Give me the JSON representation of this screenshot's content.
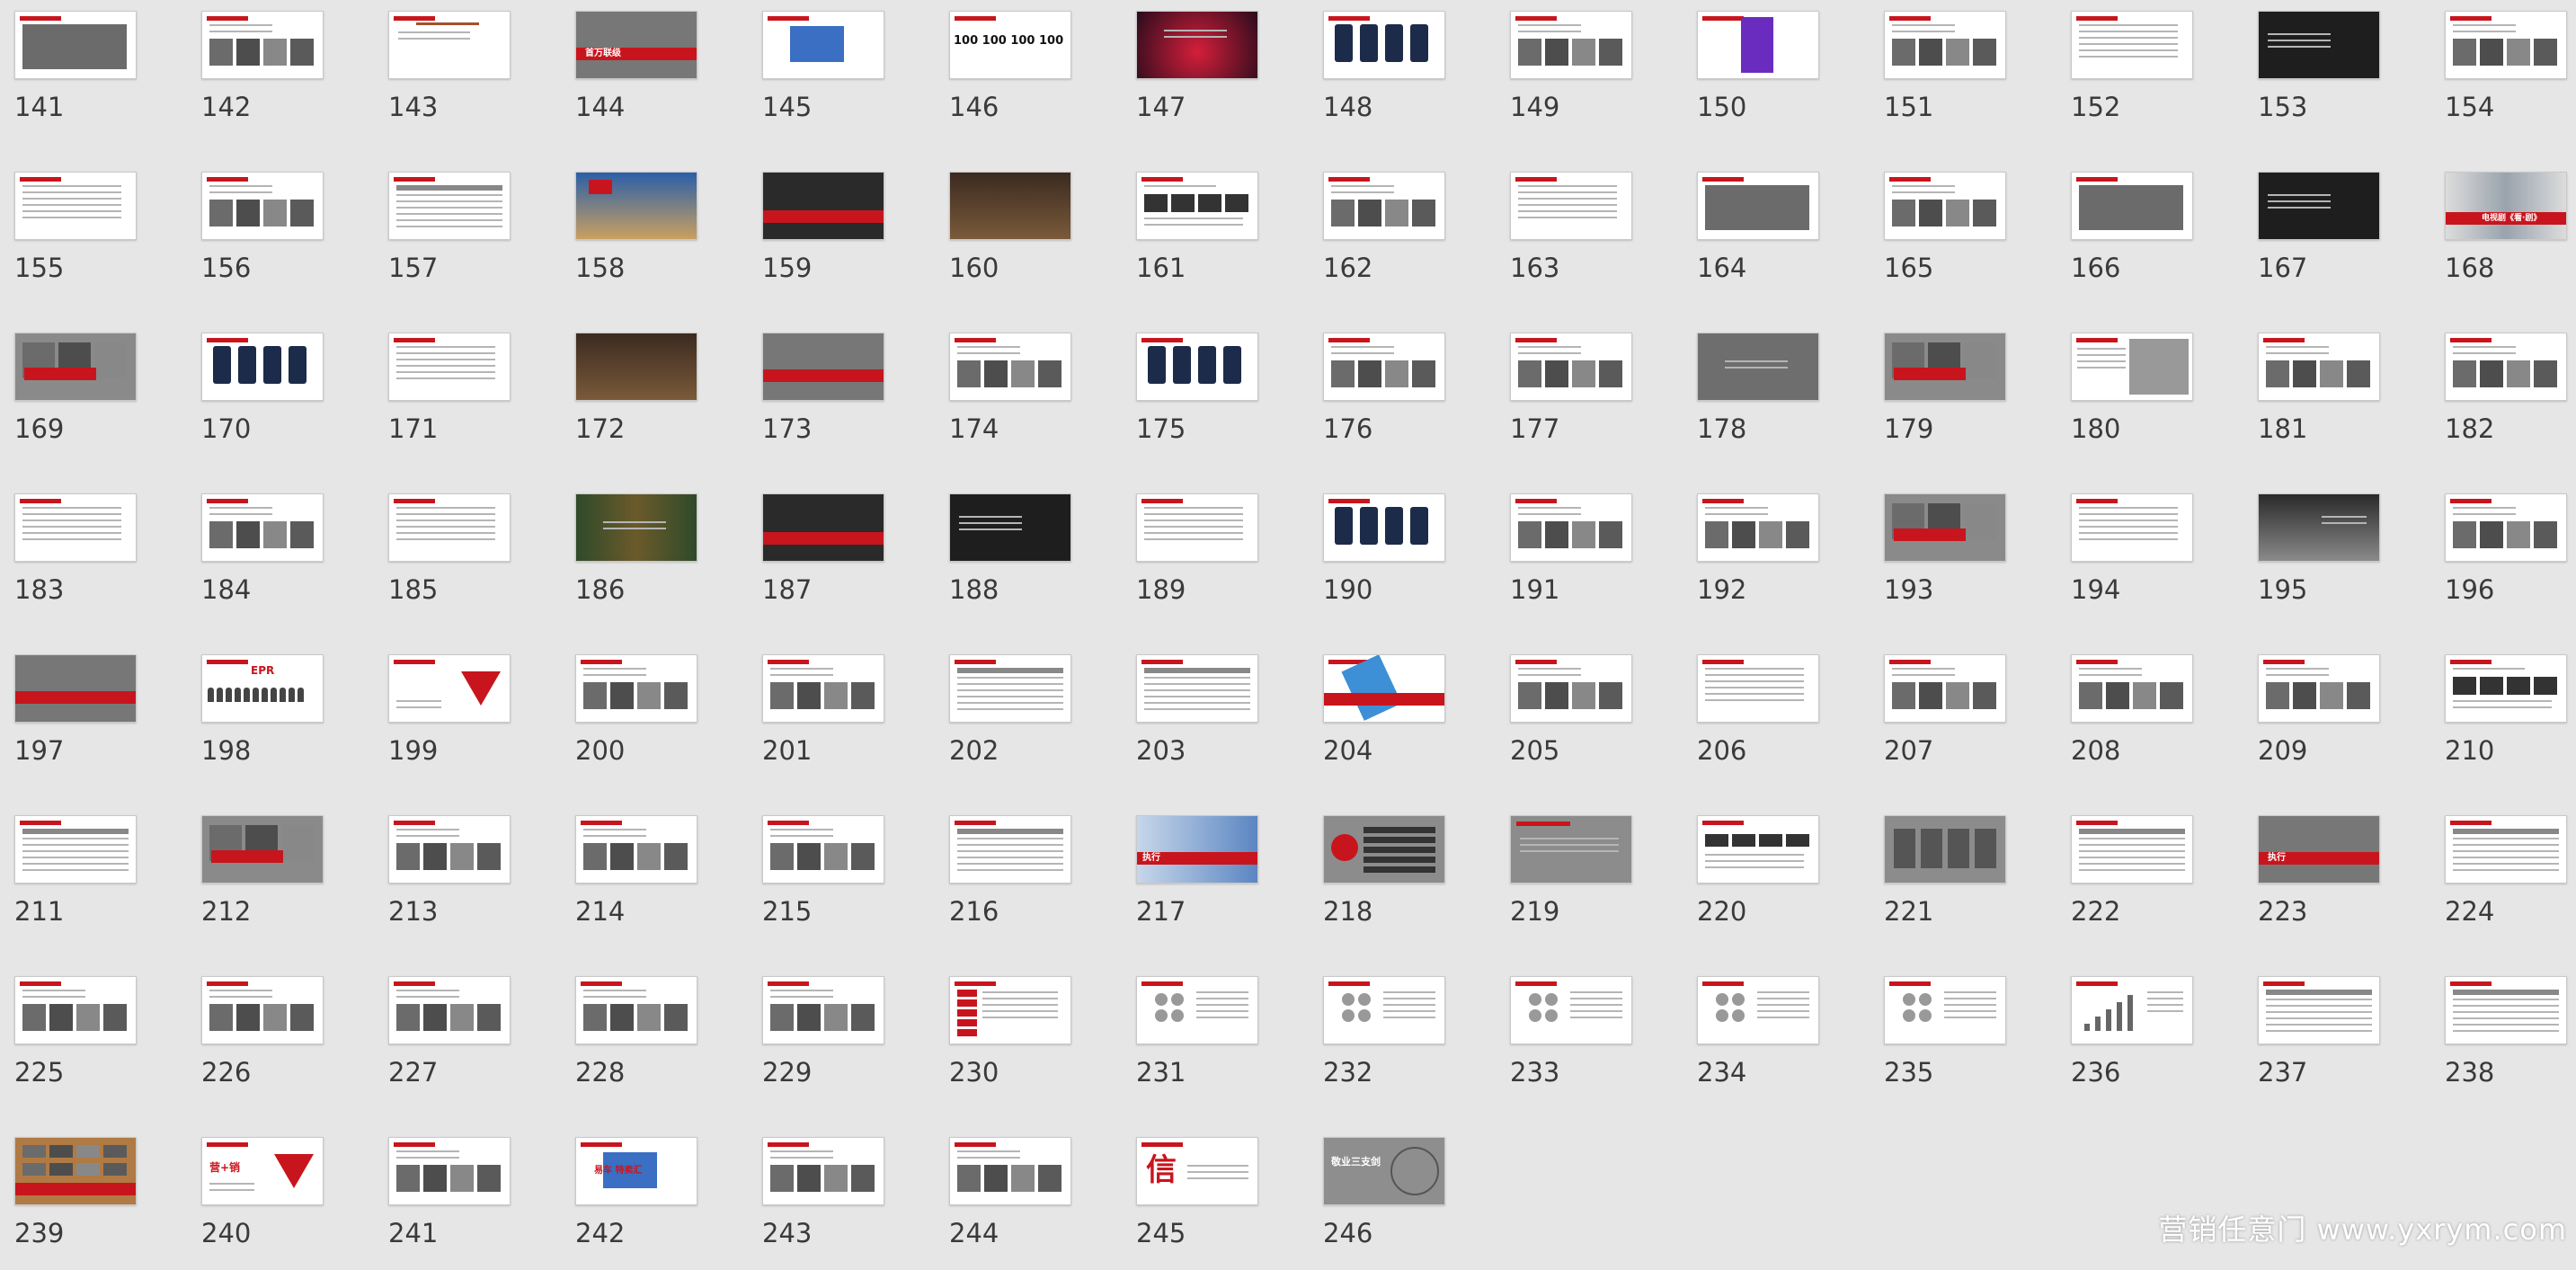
{
  "slides": [
    {
      "number": "141",
      "style": "white-photo"
    },
    {
      "number": "142",
      "style": "white-photos"
    },
    {
      "number": "143",
      "style": "white-arrow"
    },
    {
      "number": "144",
      "style": "photo-band",
      "title": "首万联级"
    },
    {
      "number": "145",
      "style": "white-logo"
    },
    {
      "number": "146",
      "style": "white-bignums",
      "title": "100 100 100 100"
    },
    {
      "number": "147",
      "style": "dark-red"
    },
    {
      "number": "148",
      "style": "white-phones"
    },
    {
      "number": "149",
      "style": "white-photos"
    },
    {
      "number": "150",
      "style": "white-purple"
    },
    {
      "number": "151",
      "style": "white-photos"
    },
    {
      "number": "152",
      "style": "white-text"
    },
    {
      "number": "153",
      "style": "dark"
    },
    {
      "number": "154",
      "style": "white-photos"
    },
    {
      "number": "155",
      "style": "white-text"
    },
    {
      "number": "156",
      "style": "white-photos"
    },
    {
      "number": "157",
      "style": "white-table"
    },
    {
      "number": "158",
      "style": "photo-sky"
    },
    {
      "number": "159",
      "style": "dark-band"
    },
    {
      "number": "160",
      "style": "dark-brown"
    },
    {
      "number": "161",
      "style": "white-icons"
    },
    {
      "number": "162",
      "style": "white-photos"
    },
    {
      "number": "163",
      "style": "white-text"
    },
    {
      "number": "164",
      "style": "white-photo"
    },
    {
      "number": "165",
      "style": "white-photos"
    },
    {
      "number": "166",
      "style": "white-photo"
    },
    {
      "number": "167",
      "style": "dark"
    },
    {
      "number": "168",
      "style": "photo-eye",
      "title": "电视剧《看·剧》"
    },
    {
      "number": "169",
      "style": "gray-photo"
    },
    {
      "number": "170",
      "style": "white-phones"
    },
    {
      "number": "171",
      "style": "white-text"
    },
    {
      "number": "172",
      "style": "dark-brown"
    },
    {
      "number": "173",
      "style": "photo-band"
    },
    {
      "number": "174",
      "style": "white-photos"
    },
    {
      "number": "175",
      "style": "white-phones"
    },
    {
      "number": "176",
      "style": "white-photos"
    },
    {
      "number": "177",
      "style": "white-photos"
    },
    {
      "number": "178",
      "style": "gray"
    },
    {
      "number": "179",
      "style": "gray-photo"
    },
    {
      "number": "180",
      "style": "white-road"
    },
    {
      "number": "181",
      "style": "white-photos"
    },
    {
      "number": "182",
      "style": "white-photos"
    },
    {
      "number": "183",
      "style": "white-text"
    },
    {
      "number": "184",
      "style": "white-photos"
    },
    {
      "number": "185",
      "style": "white-text"
    },
    {
      "number": "186",
      "style": "dark-green"
    },
    {
      "number": "187",
      "style": "dark-band"
    },
    {
      "number": "188",
      "style": "dark"
    },
    {
      "number": "189",
      "style": "white-text"
    },
    {
      "number": "190",
      "style": "white-phones"
    },
    {
      "number": "191",
      "style": "white-photos"
    },
    {
      "number": "192",
      "style": "white-photos"
    },
    {
      "number": "193",
      "style": "gray-photo"
    },
    {
      "number": "194",
      "style": "white-text"
    },
    {
      "number": "195",
      "style": "gray-dark"
    },
    {
      "number": "196",
      "style": "white-photos"
    },
    {
      "number": "197",
      "style": "photo-band"
    },
    {
      "number": "198",
      "style": "white-people",
      "title": "EPR"
    },
    {
      "number": "199",
      "style": "white-funnel"
    },
    {
      "number": "200",
      "style": "white-photos"
    },
    {
      "number": "201",
      "style": "white-photos"
    },
    {
      "number": "202",
      "style": "white-table"
    },
    {
      "number": "203",
      "style": "white-table"
    },
    {
      "number": "204",
      "style": "white-phone-band"
    },
    {
      "number": "205",
      "style": "white-photos"
    },
    {
      "number": "206",
      "style": "white-text"
    },
    {
      "number": "207",
      "style": "white-photos"
    },
    {
      "number": "208",
      "style": "white-photos"
    },
    {
      "number": "209",
      "style": "white-photos"
    },
    {
      "number": "210",
      "style": "white-icons"
    },
    {
      "number": "211",
      "style": "white-table"
    },
    {
      "number": "212",
      "style": "gray-photo"
    },
    {
      "number": "213",
      "style": "white-photos"
    },
    {
      "number": "214",
      "style": "white-photos"
    },
    {
      "number": "215",
      "style": "white-photos"
    },
    {
      "number": "216",
      "style": "white-table"
    },
    {
      "number": "217",
      "style": "photo-blue-band",
      "title": "执行"
    },
    {
      "number": "218",
      "style": "gray-list"
    },
    {
      "number": "219",
      "style": "gray-text"
    },
    {
      "number": "220",
      "style": "white-blocks"
    },
    {
      "number": "221",
      "style": "gray-table"
    },
    {
      "number": "222",
      "style": "white-table"
    },
    {
      "number": "223",
      "style": "photo-band",
      "title": "执行"
    },
    {
      "number": "224",
      "style": "white-table"
    },
    {
      "number": "225",
      "style": "white-photos"
    },
    {
      "number": "226",
      "style": "white-photos"
    },
    {
      "number": "227",
      "style": "white-photos"
    },
    {
      "number": "228",
      "style": "white-photos"
    },
    {
      "number": "229",
      "style": "white-photos"
    },
    {
      "number": "230",
      "style": "white-list"
    },
    {
      "number": "231",
      "style": "white-diagram"
    },
    {
      "number": "232",
      "style": "white-diagram"
    },
    {
      "number": "233",
      "style": "white-diagram"
    },
    {
      "number": "234",
      "style": "white-diagram"
    },
    {
      "number": "235",
      "style": "white-diagram"
    },
    {
      "number": "236",
      "style": "white-chart"
    },
    {
      "number": "237",
      "style": "white-table"
    },
    {
      "number": "238",
      "style": "white-table"
    },
    {
      "number": "239",
      "style": "photo-wood"
    },
    {
      "number": "240",
      "style": "white-funnel",
      "title": "营+销"
    },
    {
      "number": "241",
      "style": "white-photos"
    },
    {
      "number": "242",
      "style": "white-logo",
      "title": "易车 特卖汇"
    },
    {
      "number": "243",
      "style": "white-photos"
    },
    {
      "number": "244",
      "style": "white-photos"
    },
    {
      "number": "245",
      "style": "white-char",
      "title": "信"
    },
    {
      "number": "246",
      "style": "gray-circle",
      "title": "敬业三支剑"
    }
  ],
  "watermark": "营销任意门 www.yxrym.com",
  "colors": {
    "accent": "#c8151d",
    "background": "#e6e6e6"
  }
}
